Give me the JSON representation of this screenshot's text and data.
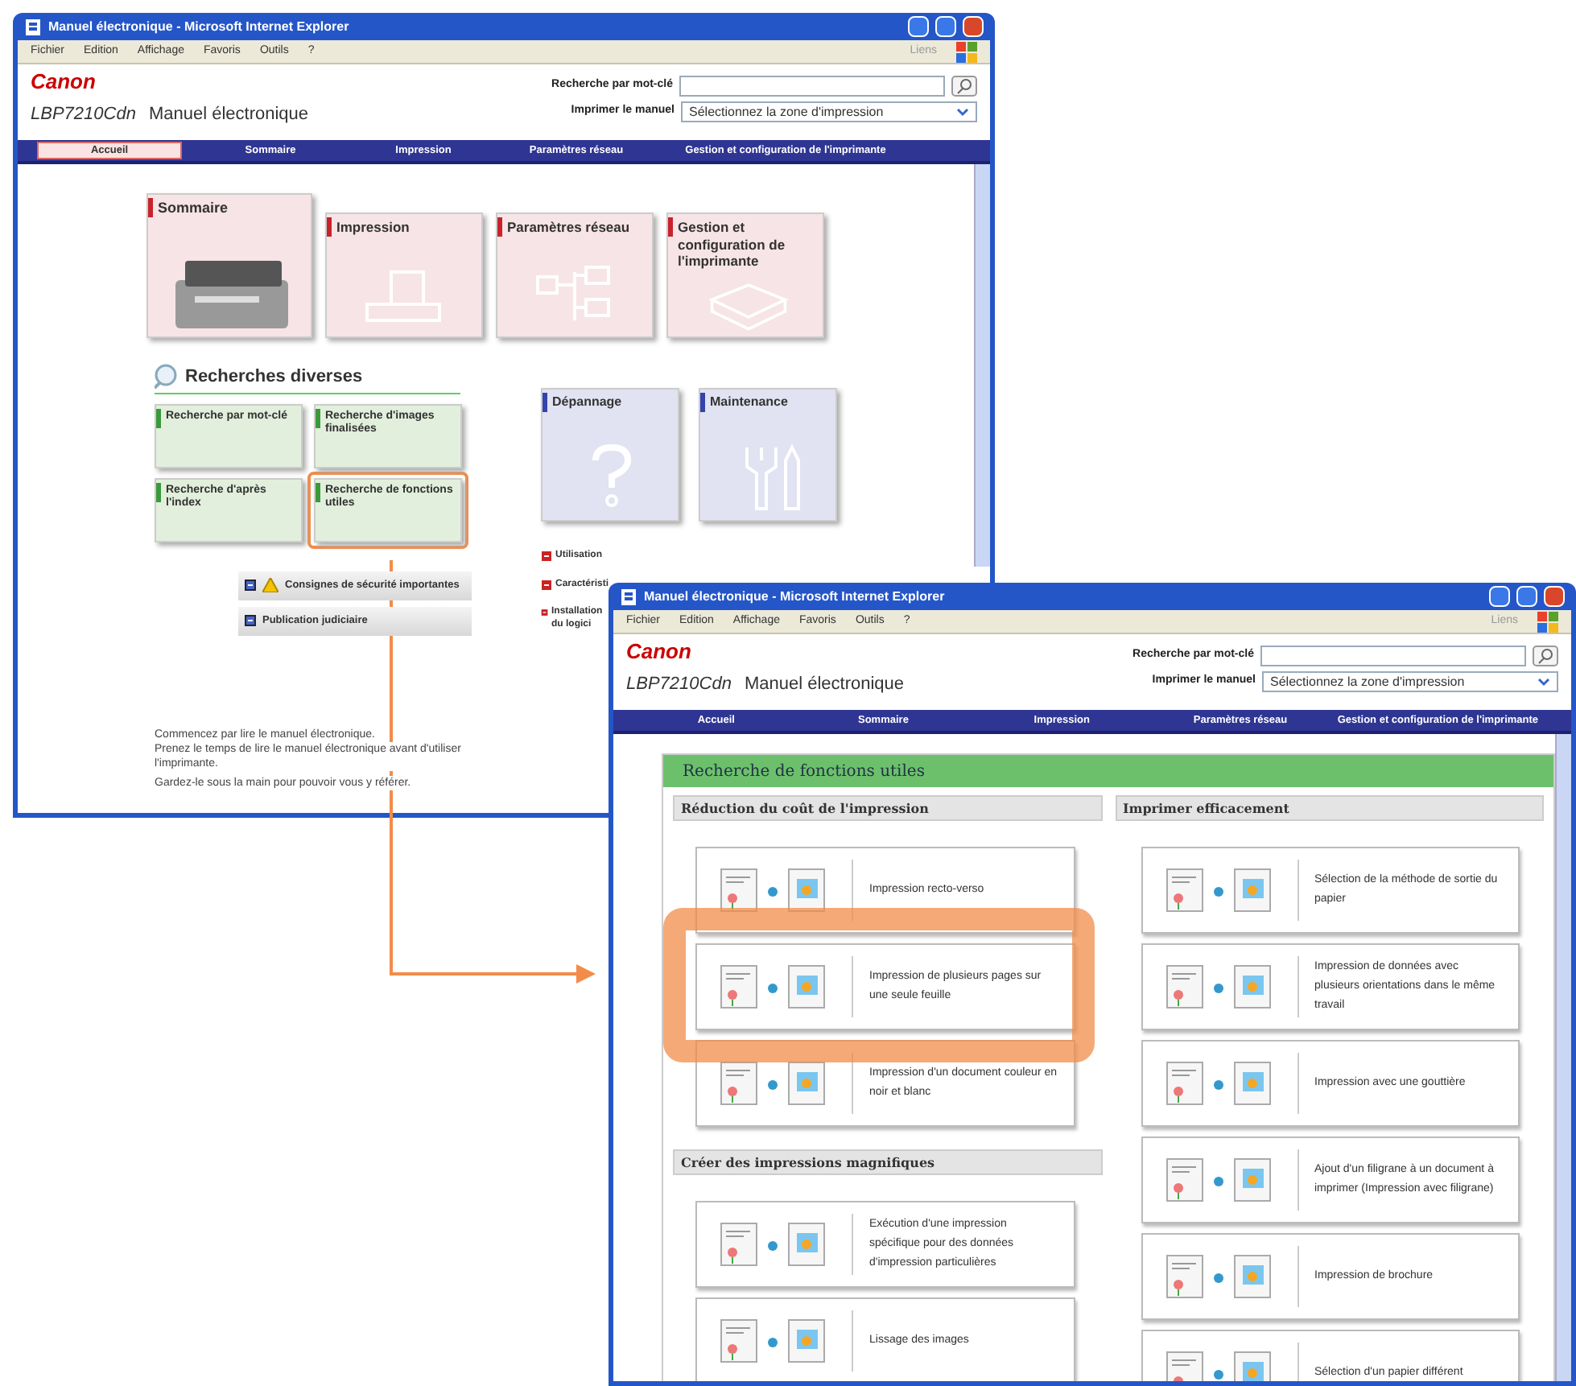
{
  "windows": [
    {
      "title": "Manuel électronique - Microsoft Internet Explorer",
      "menu": [
        "Fichier",
        "Edition",
        "Affichage",
        "Favoris",
        "Outils",
        "?"
      ],
      "links_label": "Liens",
      "logo": "Canon",
      "product": "LBP7210Cdn",
      "manual_title": "Manuel électronique",
      "search_label": "Recherche par mot-clé",
      "print_label": "Imprimer le manuel",
      "print_select": "Sélectionnez la zone d'impression",
      "nav": [
        {
          "label": "Accueil",
          "selected": true
        },
        {
          "label": "Sommaire",
          "selected": false
        },
        {
          "label": "Impression",
          "selected": false
        },
        {
          "label": "Paramètres réseau",
          "selected": false
        },
        {
          "label": "Gestion et configuration de l'imprimante",
          "selected": false
        }
      ]
    },
    {
      "title": "Manuel électronique - Microsoft Internet Explorer",
      "menu": [
        "Fichier",
        "Edition",
        "Affichage",
        "Favoris",
        "Outils",
        "?"
      ],
      "links_label": "Liens",
      "logo": "Canon",
      "product": "LBP7210Cdn",
      "manual_title": "Manuel électronique",
      "search_label": "Recherche par mot-clé",
      "print_label": "Imprimer le manuel",
      "print_select": "Sélectionnez la zone d'impression",
      "nav": [
        {
          "label": "Accueil",
          "selected": false
        },
        {
          "label": "Sommaire",
          "selected": false
        },
        {
          "label": "Impression",
          "selected": false
        },
        {
          "label": "Paramètres réseau",
          "selected": false
        },
        {
          "label": "Gestion et configuration de l'imprimante",
          "selected": false
        }
      ]
    }
  ],
  "home": {
    "main_tiles": [
      {
        "label": "Sommaire",
        "color": "#c8232c",
        "highlighted": false
      },
      {
        "label": "Impression",
        "color": "#c8232c",
        "highlighted": false
      },
      {
        "label": "Paramètres réseau",
        "color": "#c8232c",
        "highlighted": false
      },
      {
        "label": "Gestion et configuration de l'imprimante",
        "color": "#c8232c",
        "highlighted": false
      }
    ],
    "search_heading": "Recherches diverses",
    "search_tiles": [
      {
        "label": "Recherche par mot-clé",
        "color": "#3a9a3a",
        "highlighted": false
      },
      {
        "label": "Recherche d'images finalisées",
        "color": "#3a9a3a",
        "highlighted": false
      },
      {
        "label": "Recherche d'après l'index",
        "color": "#3a9a3a",
        "highlighted": false
      },
      {
        "label": "Recherche de fonctions utiles",
        "color": "#3a9a3a",
        "highlighted": true
      }
    ],
    "support_tiles": [
      {
        "label": "Dépannage",
        "color": "#3344aa",
        "highlighted": false
      },
      {
        "label": "Maintenance",
        "color": "#3344aa",
        "highlighted": false
      }
    ],
    "buttons": [
      {
        "label": "Consignes de sécurité importantes",
        "warning": true
      },
      {
        "label": "Publication judiciaire",
        "warning": false
      }
    ],
    "side_links": [
      "Utilisation",
      "Caractéristi",
      "Installation du logici"
    ],
    "intro": [
      "Commencez par lire le manuel électronique.",
      "Prenez le temps de lire le manuel électronique avant d'utiliser l'imprimante.",
      "Gardez-le sous la main pour pouvoir vous y référer."
    ]
  },
  "useful": {
    "title": "Recherche de fonctions utiles",
    "columns": [
      {
        "sections": [
          {
            "heading": "Réduction du coût de l'impression",
            "cards": [
              {
                "label": "Impression recto-verso",
                "highlighted": false
              },
              {
                "label": "Impression de plusieurs pages sur une seule feuille",
                "highlighted": true
              },
              {
                "label": "Impression d'un document couleur en noir et blanc",
                "highlighted": false
              }
            ]
          },
          {
            "heading": "Créer des impressions magnifiques",
            "cards": [
              {
                "label": "Exécution d'une impression spécifique pour des données d'impression particulières",
                "highlighted": false
              },
              {
                "label": "Lissage des images",
                "highlighted": false
              }
            ]
          }
        ]
      },
      {
        "sections": [
          {
            "heading": "Imprimer efficacement",
            "cards": [
              {
                "label": "Sélection de la méthode de sortie du papier",
                "highlighted": false
              },
              {
                "label": "Impression de données avec plusieurs orientations dans le même travail",
                "highlighted": false
              },
              {
                "label": "Impression avec une gouttière",
                "highlighted": false
              },
              {
                "label": "Ajout d'un filigrane à un document à imprimer (Impression avec filigrane)",
                "highlighted": false
              },
              {
                "label": "Impression de brochure",
                "highlighted": false
              },
              {
                "label": "Sélection d'un papier différent",
                "highlighted": false
              }
            ]
          }
        ]
      }
    ]
  }
}
